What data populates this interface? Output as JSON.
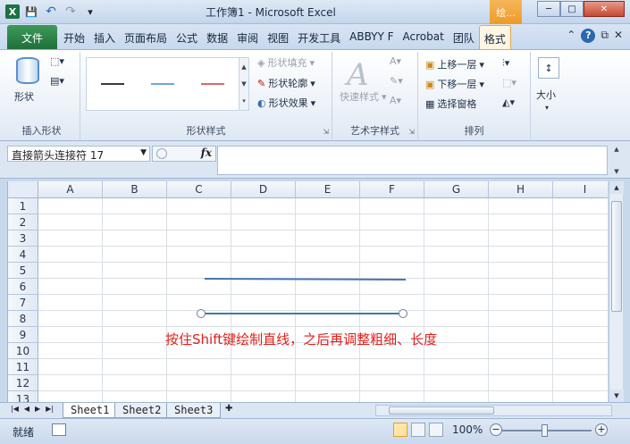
{
  "window": {
    "title": "工作簿1 - Microsoft Excel",
    "context_tab_title": "绘...",
    "buttons": {
      "minimize": "─",
      "maximize": "□",
      "close": "✕"
    }
  },
  "qat": {
    "logo": "X",
    "save": "💾",
    "undo": "↶",
    "redo": "↷",
    "more": "▾"
  },
  "ribbon_tabs": {
    "file": "文件",
    "tabs": [
      "开始",
      "插入",
      "页面布局",
      "公式",
      "数据",
      "审阅",
      "视图",
      "开发工具",
      "ABBYY F",
      "Acrobat",
      "团队",
      "格式"
    ],
    "active_index": 11
  },
  "ribbon": {
    "insert_shapes": {
      "shapes_label": "形状",
      "group_label": "插入形状"
    },
    "shape_styles": {
      "fill": "形状填充",
      "outline": "形状轮廓",
      "effects": "形状效果",
      "group_label": "形状样式",
      "gallery_colors": [
        "#3b3b3b",
        "#6fa8dc",
        "#e06666"
      ]
    },
    "wordart": {
      "quick_styles": "快速样式",
      "group_label": "艺术字样式"
    },
    "arrange": {
      "bring_forward": "上移一层",
      "send_backward": "下移一层",
      "selection_pane": "选择窗格",
      "group_label": "排列"
    },
    "size": {
      "label": "大小"
    }
  },
  "formula_bar": {
    "name_box": "直接箭头连接符 17",
    "fx": "fx",
    "formula": ""
  },
  "grid": {
    "columns": [
      "A",
      "B",
      "C",
      "D",
      "E",
      "F",
      "G",
      "H",
      "I"
    ],
    "rows": [
      "1",
      "2",
      "3",
      "4",
      "5",
      "6",
      "7",
      "8",
      "9",
      "10",
      "11",
      "12",
      "13"
    ],
    "annotation": "按住Shift键绘制直线，之后再调整粗细、长度",
    "line_color": "#4a74ad",
    "annotation_color": "#e0201a"
  },
  "sheets": {
    "tabs": [
      "Sheet1",
      "Sheet2",
      "Sheet3"
    ],
    "active_index": 0
  },
  "status": {
    "ready": "就绪",
    "zoom": "100%"
  }
}
